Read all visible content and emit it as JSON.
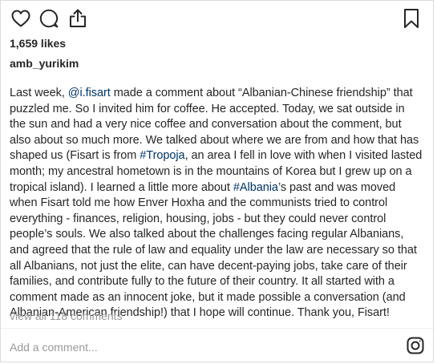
{
  "icons": {
    "like": "heart-icon",
    "comment": "comment-bubble-icon",
    "share": "share-icon",
    "save": "bookmark-icon",
    "brand": "instagram-icon"
  },
  "post": {
    "likes": "1,659 likes",
    "username": "amb_yurikim",
    "caption": {
      "t1": "Last week, ",
      "mention": "@i.fisart",
      "t2": " made a comment about “Albanian-Chinese friendship” that puzzled me. So I invited him for coffee. He accepted. Today, we sat outside in the sun and had a very nice coffee and conversation about the comment, but also about so much more. We talked about where we are from and how that has shaped us (Fisart is from ",
      "tag1": "#Tropoja",
      "t3": ", an area I fell in love with when I visited lasted month; my ancestral hometown is in the mountains of Korea but I grew up on a tropical island). I learned a little more about ",
      "tag2": "#Albania",
      "t4": "’s past and was moved when Fisart told me how Enver Hoxha and the communists tried to control everything - finances, religion, housing, jobs - but they could never control people’s souls. We also talked about the challenges facing regular Albanians, and agreed that the rule of law and equality under the law are necessary so that all Albanians, not just the elite, can have decent-paying jobs, take care of their families, and contribute fully to the future of their country. It all started with a comment made as an innocent joke, but it made possible a conversation (and Albanian-American friendship!) that I hope will continue. Thank you, Fisart!"
    },
    "view_all_comments": "view all 118 comments",
    "add_comment_placeholder": "Add a comment..."
  },
  "colors": {
    "text": "#262626",
    "link": "#003569",
    "muted": "#999999",
    "border": "#dbdbdb"
  }
}
